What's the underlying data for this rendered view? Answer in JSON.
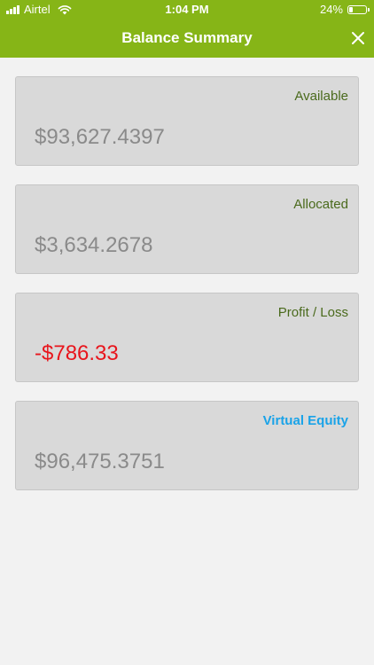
{
  "status_bar": {
    "carrier": "Airtel",
    "time": "1:04 PM",
    "battery": "24%",
    "battery_level": 0.24
  },
  "header": {
    "title": "Balance Summary",
    "close_icon": "close-icon",
    "background": "#86b517"
  },
  "cards": [
    {
      "label": "Available",
      "value": "$93,627.4397"
    },
    {
      "label": "Allocated",
      "value": "$3,634.2678"
    },
    {
      "label": "Profit / Loss",
      "value": "-$786.33",
      "value_color": "#e8151c"
    },
    {
      "label": "Virtual Equity",
      "value": "$96,475.3751",
      "label_color": "#1aa3e8"
    }
  ]
}
